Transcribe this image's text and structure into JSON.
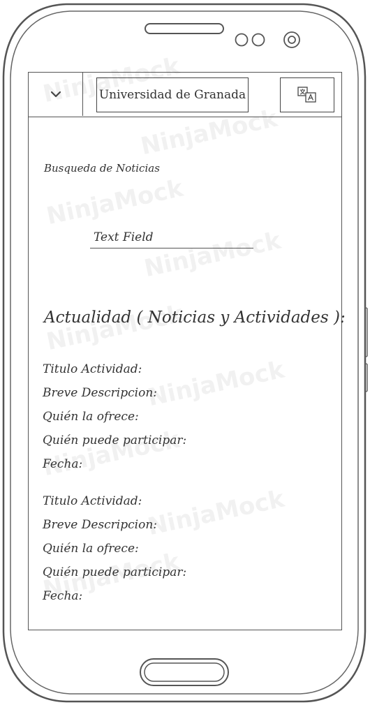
{
  "header": {
    "title": "Universidad de Granada",
    "dropdown_icon": "chevron-down-icon",
    "translate_icon": "translate-icon"
  },
  "search": {
    "label": "Busqueda de Noticias",
    "field_label": "Text Field"
  },
  "news": {
    "heading": "Actualidad ( Noticias y Actividades ):",
    "entries": [
      {
        "title": "Titulo Actividad:",
        "description": "Breve Descripcion:",
        "offered_by": "Quién la ofrece:",
        "who_can_participate": "Quién puede participar:",
        "date": "Fecha:"
      },
      {
        "title": "Titulo Actividad:",
        "description": "Breve Descripcion:",
        "offered_by": "Quién la ofrece:",
        "who_can_participate": "Quién puede participar:",
        "date": "Fecha:"
      }
    ]
  },
  "watermark": {
    "text": "NinjaMock"
  },
  "colors": {
    "outline": "#555555",
    "text": "#333333"
  }
}
